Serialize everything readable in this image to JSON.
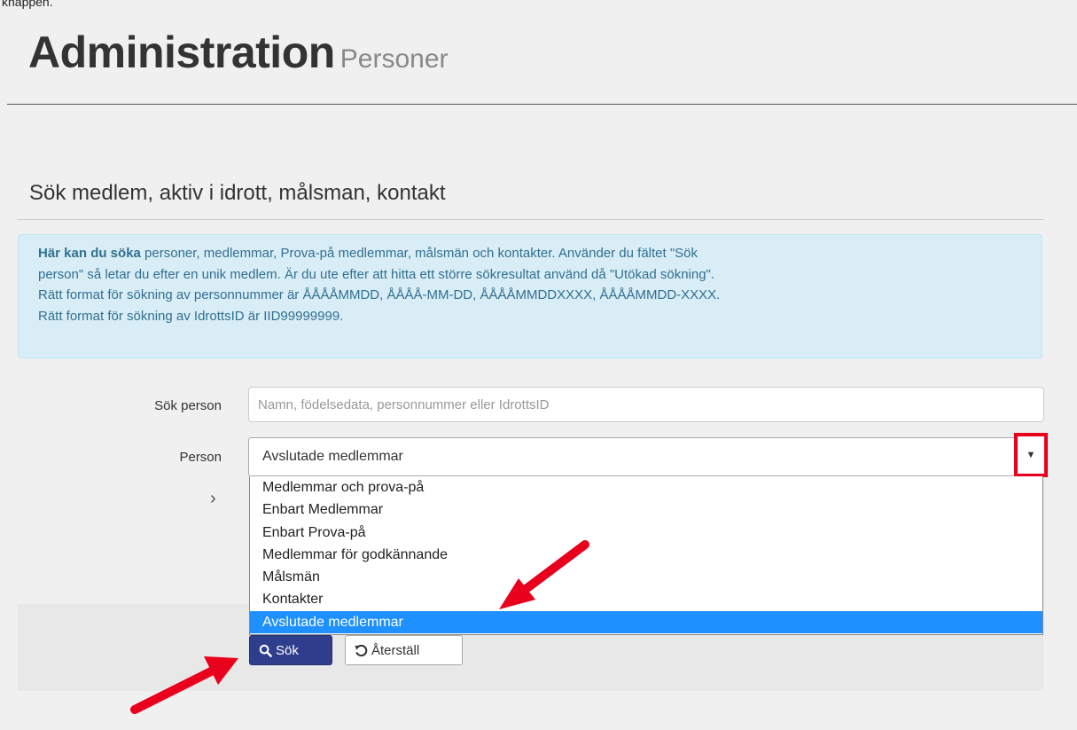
{
  "page": {
    "top_caption": "knappen.",
    "title": "Administration",
    "subtitle": "Personer"
  },
  "section": {
    "title": "Sök medlem, aktiv i idrott, målsman, kontakt"
  },
  "info": {
    "strong": "Här kan du söka",
    "line1_rest": " personer, medlemmar, Prova-på medlemmar, målsmän och kontakter. Använder du fältet \"Sök",
    "line2": "person\" så letar du efter en unik medlem. Är du ute efter att hitta ett större sökresultat använd då \"Utökad sökning\".",
    "line3": "Rätt format för sökning av personnummer är ÅÅÅÅMMDD, ÅÅÅÅ-MM-DD, ÅÅÅÅMMDDXXXX, ÅÅÅÅMMDD-XXXX.",
    "line4": "Rätt format för sökning av IdrottsID är IID99999999."
  },
  "form": {
    "search_label": "Sök person",
    "search_placeholder": "Namn, födelsedata, personnummer eller IdrottsID",
    "search_value": "",
    "person_label": "Person",
    "person_selected": "Avslutade medlemmar",
    "options": [
      "Medlemmar och prova-på",
      "Enbart Medlemmar",
      "Enbart Prova-på",
      "Medlemmar för godkännande",
      "Målsmän",
      "Kontakter",
      "Avslutade medlemmar"
    ],
    "selected_index": 6,
    "expand_chevron": "›",
    "select_arrow_glyph": "▼"
  },
  "buttons": {
    "search_label": "Sök",
    "reset_label": "Återställ",
    "search_icon": "search-icon",
    "reset_icon": "undo-icon"
  },
  "colors": {
    "primary_button": "#2e3d8c",
    "info_background": "#d9edf7",
    "info_text": "#31708f",
    "highlight_option": "#1e90ff",
    "annotation_red": "#e8001c"
  }
}
